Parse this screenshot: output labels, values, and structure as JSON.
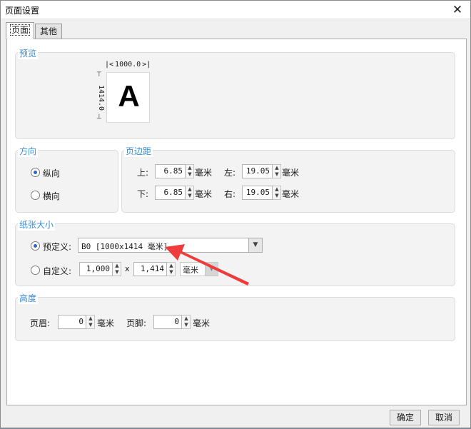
{
  "window": {
    "title": "页面设置",
    "close_glyph": "✕"
  },
  "tabs": [
    {
      "label": "页面",
      "active": true
    },
    {
      "label": "其他",
      "active": false
    }
  ],
  "preview": {
    "title": "预览",
    "width_value": "1000.0",
    "height_value": "1414.0",
    "letter": "A"
  },
  "orientation": {
    "title": "方向",
    "options": [
      {
        "label": "纵向",
        "checked": true
      },
      {
        "label": "横向",
        "checked": false
      }
    ]
  },
  "margins": {
    "title": "页边距",
    "top": {
      "label": "上:",
      "value": "6.85",
      "unit": "毫米"
    },
    "bottom": {
      "label": "下:",
      "value": "6.85",
      "unit": "毫米"
    },
    "left": {
      "label": "左:",
      "value": "19.05",
      "unit": "毫米"
    },
    "right": {
      "label": "右:",
      "value": "19.05",
      "unit": "毫米"
    }
  },
  "paper": {
    "title": "纸张大小",
    "predefined": {
      "label": "预定义:",
      "checked": true,
      "value": "B0 [1000x1414 毫米]"
    },
    "custom": {
      "label": "自定义:",
      "checked": false,
      "width": "1,000",
      "separator": "x",
      "height": "1,414",
      "unit": "毫米"
    }
  },
  "height_group": {
    "title": "高度",
    "header": {
      "label": "页眉:",
      "value": "0",
      "unit": "毫米"
    },
    "footer": {
      "label": "页脚:",
      "value": "0",
      "unit": "毫米"
    }
  },
  "buttons": {
    "ok": "确定",
    "cancel": "取消"
  },
  "colors": {
    "accent": "#3a8fd8",
    "annotation_arrow": "#ee3b3b"
  }
}
